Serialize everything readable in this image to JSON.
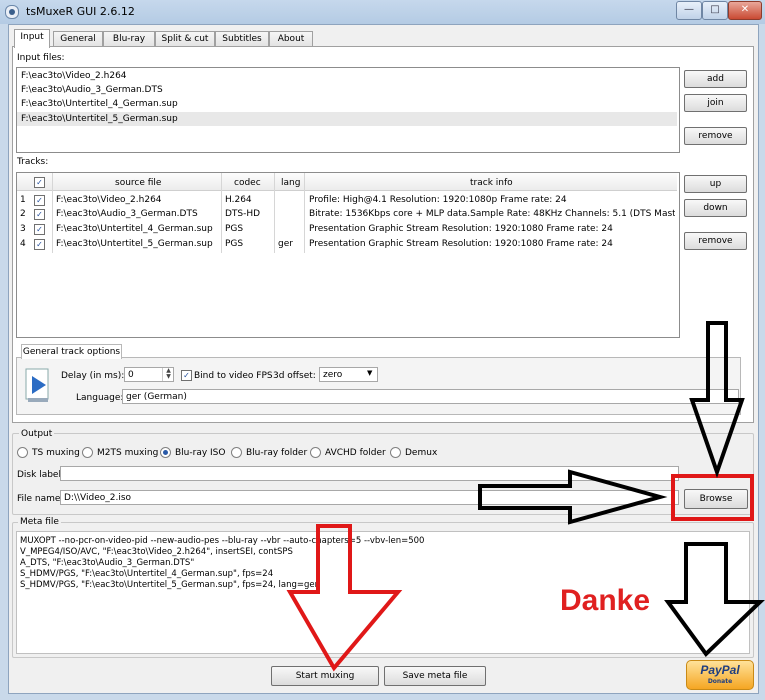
{
  "window": {
    "title": "tsMuxeR GUI 2.6.12"
  },
  "tabs": [
    "Input",
    "General",
    "Blu-ray",
    "Split & cut",
    "Subtitles",
    "About"
  ],
  "input": {
    "files_label": "Input files:",
    "files": [
      "F:\\eac3to\\Video_2.h264",
      "F:\\eac3to\\Audio_3_German.DTS",
      "F:\\eac3to\\Untertitel_4_German.sup",
      "F:\\eac3to\\Untertitel_5_German.sup"
    ],
    "buttons": {
      "add": "add",
      "join": "join",
      "remove": "remove"
    }
  },
  "tracks": {
    "label": "Tracks:",
    "headers": {
      "source": "source file",
      "codec": "codec",
      "lang": "lang",
      "info": "track info"
    },
    "rows": [
      {
        "num": "1",
        "source": "F:\\eac3to\\Video_2.h264",
        "codec": "H.264",
        "lang": "",
        "info": "Profile: High@4.1  Resolution: 1920:1080p  Frame rate: 24"
      },
      {
        "num": "2",
        "source": "F:\\eac3to\\Audio_3_German.DTS",
        "codec": "DTS-HD",
        "lang": "",
        "info": "Bitrate: 1536Kbps  core + MLP data.Sample Rate: 48KHz  Channels: 5.1 (DTS Mast..."
      },
      {
        "num": "3",
        "source": "F:\\eac3to\\Untertitel_4_German.sup",
        "codec": "PGS",
        "lang": "",
        "info": "Presentation Graphic Stream Resolution: 1920:1080 Frame rate: 24"
      },
      {
        "num": "4",
        "source": "F:\\eac3to\\Untertitel_5_German.sup",
        "codec": "PGS",
        "lang": "ger",
        "info": "Presentation Graphic Stream Resolution: 1920:1080 Frame rate: 24"
      }
    ],
    "buttons": {
      "up": "up",
      "down": "down",
      "remove": "remove"
    }
  },
  "track_options": {
    "tab": "General track options",
    "delay_label": "Delay (in ms):",
    "delay_value": "0",
    "bind_fps": "Bind to video FPS",
    "offset_label": "3d offset:",
    "offset_value": "zero",
    "language_label": "Language:",
    "language_value": "ger (German)"
  },
  "output": {
    "label": "Output",
    "modes": [
      "TS muxing",
      "M2TS muxing",
      "Blu-ray ISO",
      "Blu-ray folder",
      "AVCHD folder",
      "Demux"
    ],
    "disk_label": "Disk label",
    "disk_value": "",
    "file_label": "File name",
    "file_value": "D:\\\\Video_2.iso",
    "browse": "Browse"
  },
  "meta": {
    "label": "Meta file",
    "lines": [
      "MUXOPT --no-pcr-on-video-pid --new-audio-pes --blu-ray --vbr  --auto-chapters=5 --vbv-len=500",
      "V_MPEG4/ISO/AVC, \"F:\\eac3to\\Video_2.h264\", insertSEI, contSPS",
      "A_DTS, \"F:\\eac3to\\Audio_3_German.DTS\"",
      "S_HDMV/PGS, \"F:\\eac3to\\Untertitel_4_German.sup\", fps=24",
      "S_HDMV/PGS, \"F:\\eac3to\\Untertitel_5_German.sup\", fps=24, lang=ger"
    ]
  },
  "actions": {
    "start": "Start muxing",
    "save": "Save meta file"
  },
  "annotation": {
    "text": "Danke",
    "color": "#e02020"
  },
  "paypal": {
    "brand": "PayPal",
    "sub": "Donate"
  }
}
